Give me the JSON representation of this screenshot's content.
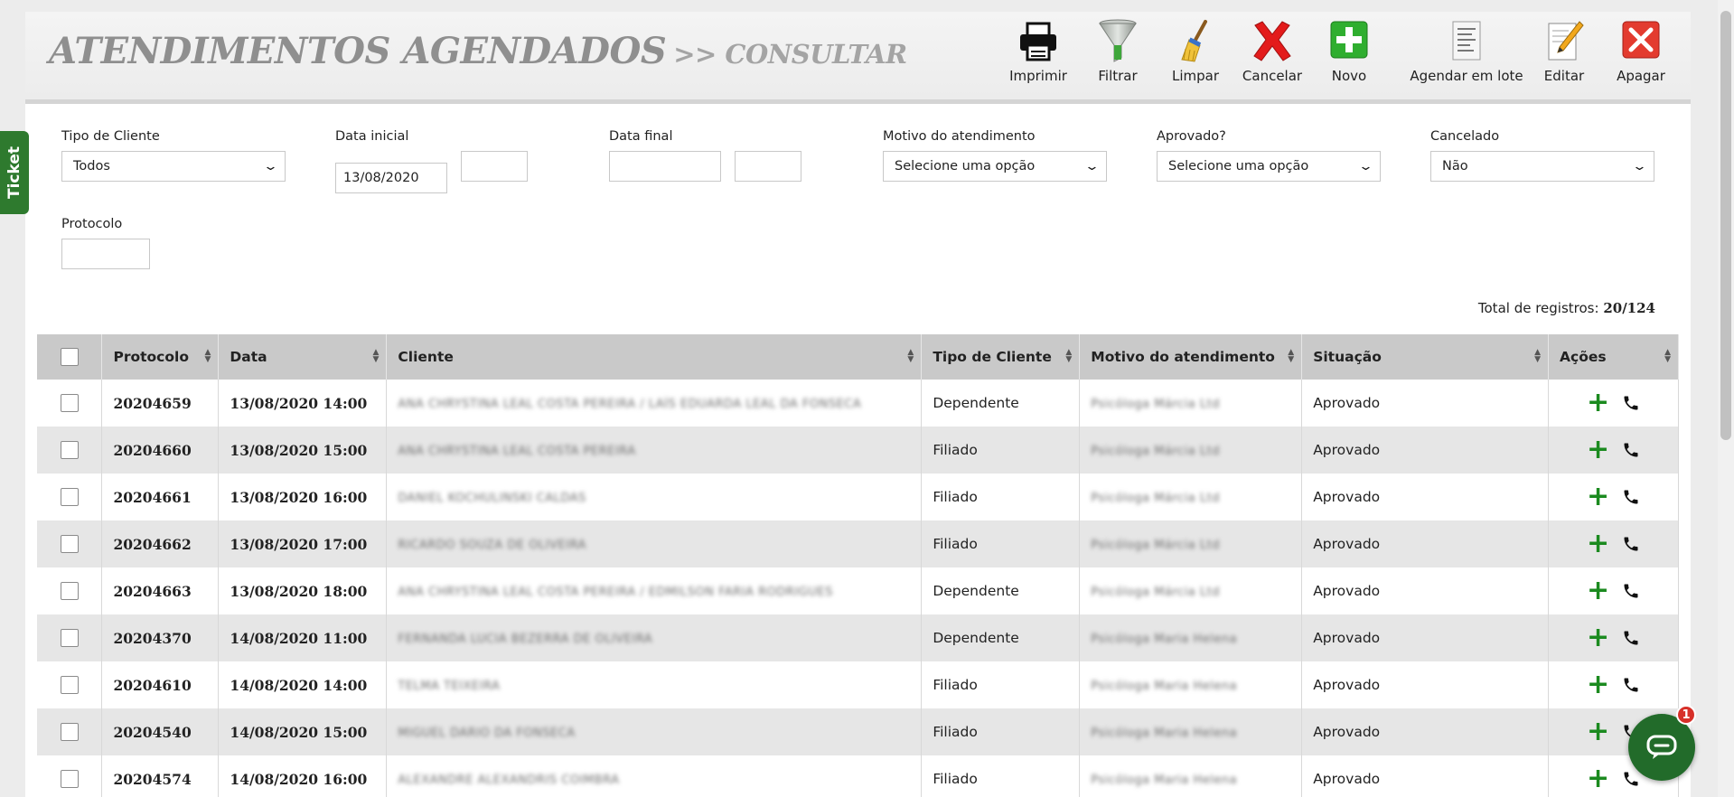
{
  "header": {
    "title": "ATENDIMENTOS AGENDADOS",
    "subtitle": ">> CONSULTAR"
  },
  "toolbar": {
    "print": "Imprimir",
    "filter": "Filtrar",
    "clear": "Limpar",
    "cancel": "Cancelar",
    "new": "Novo",
    "batch": "Agendar em lote",
    "edit": "Editar",
    "delete": "Apagar"
  },
  "side_tab": "Ticket",
  "filters": {
    "tipo_cliente": {
      "label": "Tipo de Cliente",
      "value": "Todos"
    },
    "data_inicial": {
      "label": "Data inicial",
      "date": "13/08/2020",
      "time": ""
    },
    "data_final": {
      "label": "Data final",
      "date": "",
      "time": ""
    },
    "motivo": {
      "label": "Motivo do atendimento",
      "value": "Selecione uma opção"
    },
    "aprovado": {
      "label": "Aprovado?",
      "value": "Selecione uma opção"
    },
    "cancelado": {
      "label": "Cancelado",
      "value": "Não"
    },
    "protocolo": {
      "label": "Protocolo",
      "value": ""
    }
  },
  "total": {
    "label": "Total de registros:",
    "value": "20/124"
  },
  "table": {
    "columns": [
      "Protocolo",
      "Data",
      "Cliente",
      "Tipo de Cliente",
      "Motivo do atendimento",
      "Situação",
      "Ações"
    ],
    "rows": [
      {
        "protocolo": "20204659",
        "data": "13/08/2020 14:00",
        "cliente": "ANA CHRYSTINA LEAL COSTA PEREIRA / LAÍS EDUARDA LEAL DA FONSECA",
        "tipo": "Dependente",
        "motivo": "Psicóloga Márcia Ltd",
        "situacao": "Aprovado"
      },
      {
        "protocolo": "20204660",
        "data": "13/08/2020 15:00",
        "cliente": "ANA CHRYSTINA LEAL COSTA PEREIRA",
        "tipo": "Filiado",
        "motivo": "Psicóloga Márcia Ltd",
        "situacao": "Aprovado"
      },
      {
        "protocolo": "20204661",
        "data": "13/08/2020 16:00",
        "cliente": "DANIEL KOCHULINSKI CALDAS",
        "tipo": "Filiado",
        "motivo": "Psicóloga Márcia Ltd",
        "situacao": "Aprovado"
      },
      {
        "protocolo": "20204662",
        "data": "13/08/2020 17:00",
        "cliente": "RICARDO SOUZA DE OLIVEIRA",
        "tipo": "Filiado",
        "motivo": "Psicóloga Márcia Ltd",
        "situacao": "Aprovado"
      },
      {
        "protocolo": "20204663",
        "data": "13/08/2020 18:00",
        "cliente": "ANA CHRYSTINA LEAL COSTA PEREIRA / EDMILSON FARIA RODRIGUES",
        "tipo": "Dependente",
        "motivo": "Psicóloga Márcia Ltd",
        "situacao": "Aprovado"
      },
      {
        "protocolo": "20204370",
        "data": "14/08/2020 11:00",
        "cliente": "FERNANDA LUCIA BEZERRA DE OLIVEIRA",
        "tipo": "Dependente",
        "motivo": "Psicóloga Maria Helena",
        "situacao": "Aprovado"
      },
      {
        "protocolo": "20204610",
        "data": "14/08/2020 14:00",
        "cliente": "TELMA TEIXEIRA",
        "tipo": "Filiado",
        "motivo": "Psicóloga Maria Helena",
        "situacao": "Aprovado"
      },
      {
        "protocolo": "20204540",
        "data": "14/08/2020 15:00",
        "cliente": "MIGUEL DARIO DA FONSECA",
        "tipo": "Filiado",
        "motivo": "Psicóloga Maria Helena",
        "situacao": "Aprovado"
      },
      {
        "protocolo": "20204574",
        "data": "14/08/2020 16:00",
        "cliente": "ALEXANDRE ALEXANDRIS COIMBRA",
        "tipo": "Filiado",
        "motivo": "Psicóloga Maria Helena",
        "situacao": "Aprovado"
      }
    ]
  },
  "chat": {
    "badge": "1"
  },
  "colors": {
    "accent_green": "#1b8a1f",
    "delete_red": "#e02020",
    "header_gray": "#c9c9c9"
  }
}
